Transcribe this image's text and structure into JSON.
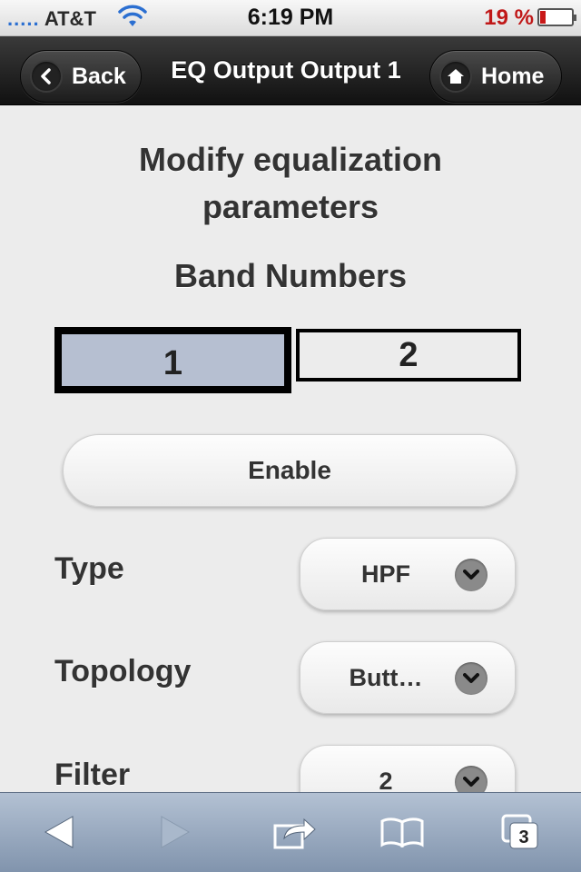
{
  "status_bar": {
    "signal_bars": ".....",
    "carrier": "AT&T",
    "time": "6:19 PM",
    "battery_percent": "19 %",
    "battery_level": 0.19,
    "wifi_icon": "wifi-icon"
  },
  "header": {
    "back_label": "Back",
    "title": "EQ Output Output 1",
    "home_label": "Home"
  },
  "main": {
    "heading_line1": "Modify equalization",
    "heading_line2": "parameters",
    "band_heading": "Band Numbers",
    "bands": [
      {
        "label": "1",
        "selected": true
      },
      {
        "label": "2",
        "selected": false
      }
    ],
    "enable_label": "Enable",
    "fields": [
      {
        "label": "Type",
        "value": "HPF"
      },
      {
        "label": "Topology",
        "value": "Butt…"
      },
      {
        "label": "Filter",
        "value": "2"
      }
    ]
  },
  "toolbar": {
    "tabs_count": "3"
  },
  "colors": {
    "selected_band": "#b6bfd1",
    "header_bg": "#1c1c1c",
    "battery_low": "#c81818",
    "toolbar_bg": "#94a6bd"
  }
}
